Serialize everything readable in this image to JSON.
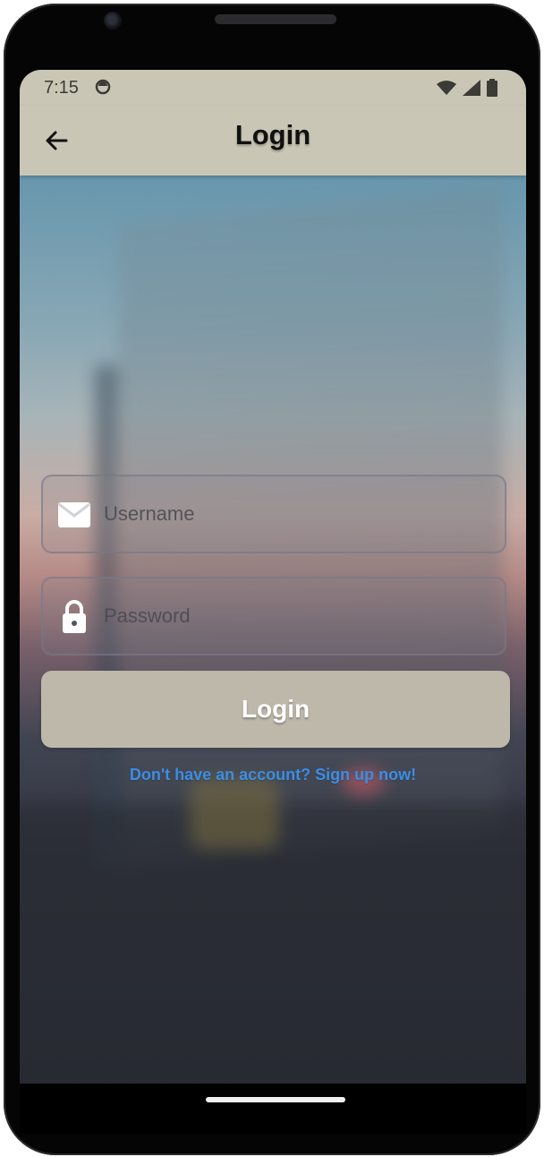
{
  "status_bar": {
    "time": "7:15",
    "sync_icon": "sync-icon",
    "icons": [
      "wifi-icon",
      "signal-icon",
      "battery-icon"
    ]
  },
  "app_bar": {
    "title": "Login",
    "back_icon": "back-arrow-icon"
  },
  "form": {
    "username": {
      "placeholder": "Username",
      "value": "",
      "icon": "mail-icon"
    },
    "password": {
      "placeholder": "Password",
      "value": "",
      "icon": "lock-icon"
    },
    "login_label": "Login",
    "signup_link": "Don't have an account? Sign up now!"
  },
  "colors": {
    "app_bar_background": "#cac6b6",
    "button_background": "#bdb8aa",
    "link_text": "#3b8ee6"
  }
}
